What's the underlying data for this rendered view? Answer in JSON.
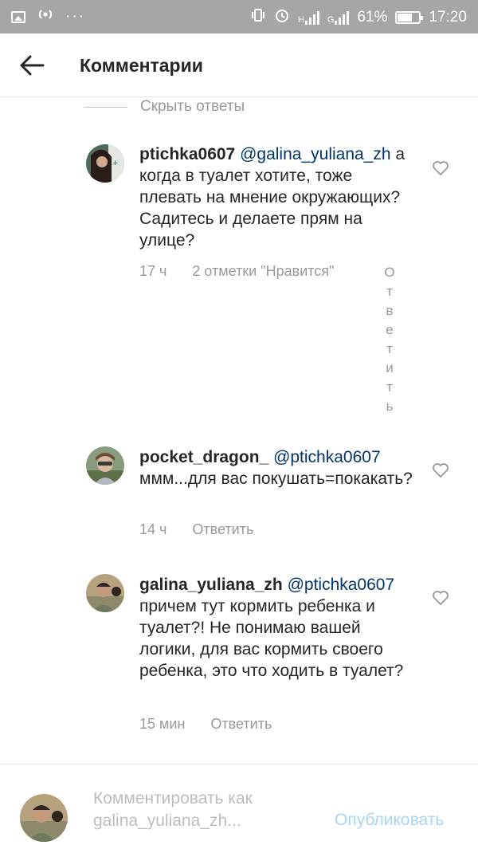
{
  "status_bar": {
    "network_1": "H",
    "network_2": "G",
    "battery_percent": "61%",
    "battery_level": 0.61,
    "time": "17:20"
  },
  "header": {
    "title": "Комментарии"
  },
  "hide_replies": "Скрыть ответы",
  "comments": [
    {
      "username": "ptichka0607",
      "mention": "@galina_yuliana_zh",
      "text": "а когда в туалет хотите, тоже плевать на мнение окружающих? Садитесь и делаете прям на улице?",
      "time": "17 ч",
      "likes": "2 отметки \"Нравится\"",
      "reply": "Ответить"
    },
    {
      "username": "pocket_dragon_",
      "mention": "@ptichka0607",
      "text": "ммм...для вас покушать=покакать?",
      "time": "14 ч",
      "reply": "Ответить"
    },
    {
      "username": "galina_yuliana_zh",
      "mention": "@ptichka0607",
      "text": "причем тут кормить ребенка и туалет?! Не понимаю вашей логики, для вас кормить своего ребенка, это что ходить в туалет?",
      "time": "15 мин",
      "reply": "Ответить"
    }
  ],
  "composer": {
    "placeholder": "Комментировать как galina_yuliana_zh...",
    "publish_label": "Опубликовать"
  },
  "colors": {
    "status_bar_bg": "#a6a6a6",
    "mention": "#003569",
    "meta": "#999999",
    "publish_disabled": "#a8d4f5"
  }
}
